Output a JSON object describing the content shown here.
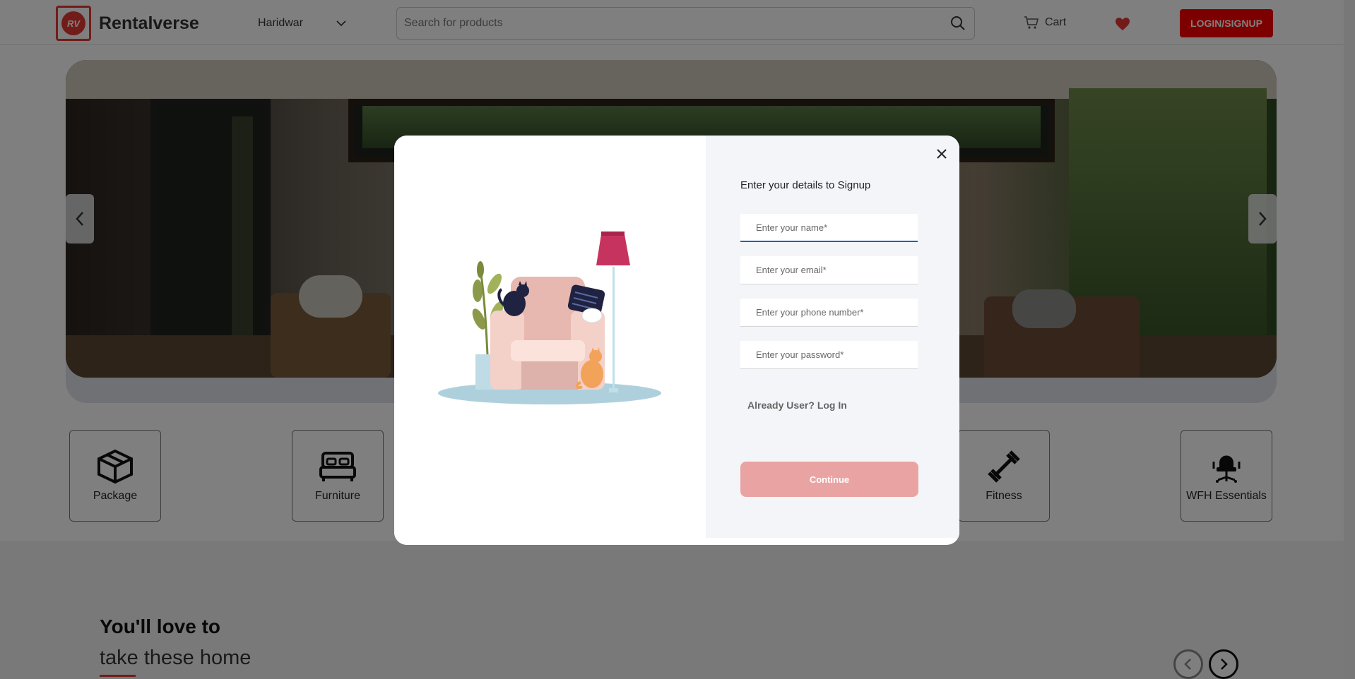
{
  "header": {
    "brand": "Rentalverse",
    "logo_text": "RV",
    "city": "Haridwar",
    "search_placeholder": "Search for products",
    "cart_label": "Cart",
    "login_label": "LOGIN/SIGNUP"
  },
  "categories": [
    {
      "label": "Package",
      "icon": "package-icon"
    },
    {
      "label": "Furniture",
      "icon": "bed-icon"
    },
    {
      "label": "Fitness",
      "icon": "dumbbell-icon"
    },
    {
      "label": "WFH Essentials",
      "icon": "office-chair-icon"
    }
  ],
  "section": {
    "title": "You'll love to",
    "subtitle": "take these home"
  },
  "modal": {
    "title": "Enter your details to Signup",
    "name_placeholder": "Enter your name*",
    "email_placeholder": "Enter your email*",
    "phone_placeholder": "Enter your phone number*",
    "password_placeholder": "Enter your password*",
    "already_user": "Already User? Log In",
    "continue_label": "Continue"
  },
  "colors": {
    "brand_red": "#f80000",
    "continue_disabled": "#eaa3a3",
    "focus_blue": "#1a5fd0"
  }
}
